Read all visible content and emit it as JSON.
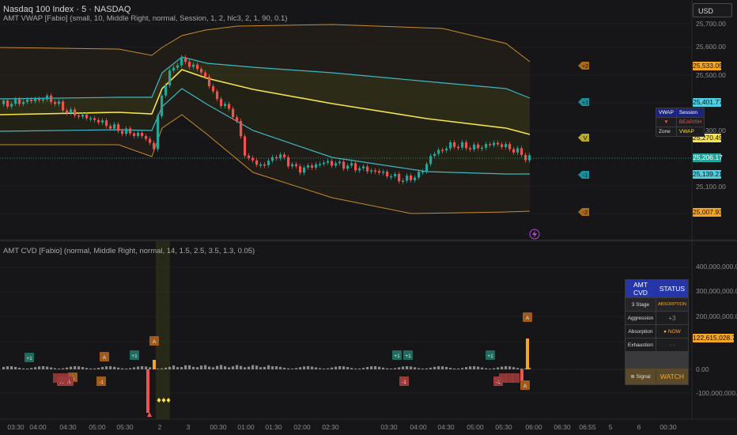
{
  "header": {
    "symbol_title": "Nasdaq 100 Index · 5 · NASDAQ",
    "vwap_indicator": "AMT VWAP [Fabio] (small, 10, Middle Right, normal, Session, 1, 2, hlc3, 2, 1, 90, 0.1)",
    "cvd_indicator": "AMT CVD [Fabio] (normal, Middle Right, normal, 14, 1.5, 2.5, 3.5, 1.3, 0.05)",
    "currency_button": "USD"
  },
  "price_axis": {
    "labels": [
      "25,700.00",
      "25,600.00",
      "25,500.00",
      "25,300.00",
      "25,100.00"
    ],
    "tags": [
      {
        "text": "25,533.05",
        "color": "#f5a623"
      },
      {
        "text": "25,401.77",
        "color": "#4dd0e1"
      },
      {
        "text": "25,270.49",
        "color": "#f7e34b"
      },
      {
        "text": "25,206.17",
        "color": "#26a69a"
      },
      {
        "text": "25,139.21",
        "color": "#4dd0e1"
      },
      {
        "text": "25,007.93",
        "color": "#f5a623"
      }
    ],
    "band_markers": [
      "+2",
      "+1",
      "V",
      "-1",
      "-2"
    ]
  },
  "cvd_axis": {
    "labels": [
      "400,000,000.00",
      "300,000,000.00",
      "200,000,000.00",
      "0.00",
      "-100,000,000.00"
    ],
    "current_tag": "122,615,028.75",
    "current_color": "#f5a623"
  },
  "time_axis": [
    "03:30",
    "04:00",
    "04:30",
    "05:00",
    "05:30",
    "2",
    "3",
    "00:30",
    "01:00",
    "01:30",
    "02:00",
    "02:30",
    "03:30",
    "04:00",
    "04:30",
    "05:00",
    "05:30",
    "06:00",
    "06:30",
    "06:55",
    "5",
    "6",
    "00:30"
  ],
  "vwap_table": {
    "rows": [
      [
        "VWAP",
        "Session"
      ],
      [
        "▼",
        "BEARISH"
      ],
      [
        "Zone",
        "VWAP"
      ]
    ]
  },
  "cvd_table": {
    "header": [
      "AMT CVD",
      "STATUS"
    ],
    "rows": [
      [
        "3 Stage",
        "ABSORPTION"
      ],
      [
        "Aggression",
        "+3"
      ],
      [
        "Absorption",
        "● NOW"
      ],
      [
        "Exhaustion",
        "- -"
      ],
      [
        "",
        ""
      ],
      [
        "⊕ Signal",
        "WATCH"
      ]
    ]
  },
  "cvd_markers": [
    "+1",
    "A",
    "A",
    "+1",
    "A",
    "-1",
    "+1",
    "+1",
    "-1",
    "+1",
    "A",
    "A",
    "-1",
    "A",
    "A"
  ],
  "colors": {
    "bull": "#26a69a",
    "bear": "#ef5350",
    "vwap": "#f7e34b",
    "band1": "#4dd0e1",
    "band2": "#f5a623",
    "cvd_neutral": "#9e9e9e"
  }
}
